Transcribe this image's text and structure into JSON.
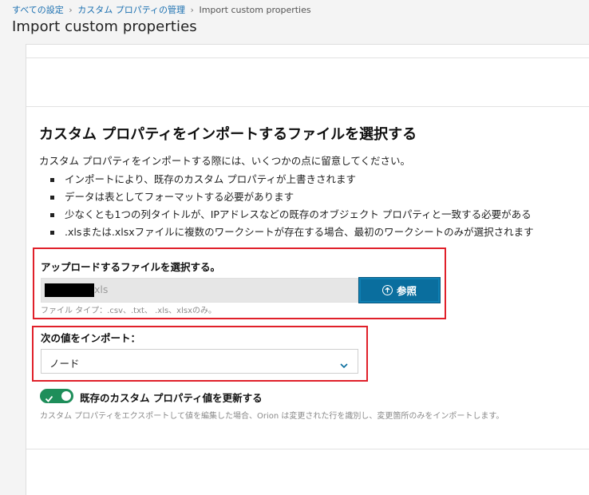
{
  "breadcrumb": {
    "items": [
      "すべての設定",
      "カスタム プロパティの管理",
      "Import custom properties"
    ]
  },
  "page_title": "Import custom properties",
  "section": {
    "heading": "カスタム プロパティをインポートするファイルを選択する",
    "intro": "カスタム プロパティをインポートする際には、いくつかの点に留意してください。",
    "bullets": [
      "インポートにより、既存のカスタム プロパティが上書きされます",
      "データは表としてフォーマットする必要があります",
      "少なくとも1つの列タイトルが、IPアドレスなどの既存のオブジェクト プロパティと一致する必要がある",
      ".xlsまたは.xlsxファイルに複数のワークシートが存在する場合、最初のワークシートのみが選択されます"
    ]
  },
  "upload": {
    "label": "アップロードするファイルを選択する。",
    "file_ext": "xls",
    "browse_label": "参照",
    "hint": "ファイル タイプ：.csv、.txt、 .xls、xlsxのみ。"
  },
  "import_value": {
    "label": "次の値をインポート：",
    "selected": "ノード"
  },
  "update_toggle": {
    "label": "既存のカスタム プロパティ値を更新する",
    "description": "カスタム プロパティをエクスポートして値を編集した場合、Orion は変更された行を識別し、変更箇所のみをインポートします。",
    "enabled": true
  },
  "colors": {
    "accent": "#0a6e9e",
    "toggle_on": "#1e8e5a",
    "highlight_box": "#e0202a",
    "link": "#1a6fb0"
  },
  "icons": {
    "browse": "upload-icon",
    "select": "chevron-down-icon",
    "toggle": "check-icon"
  }
}
